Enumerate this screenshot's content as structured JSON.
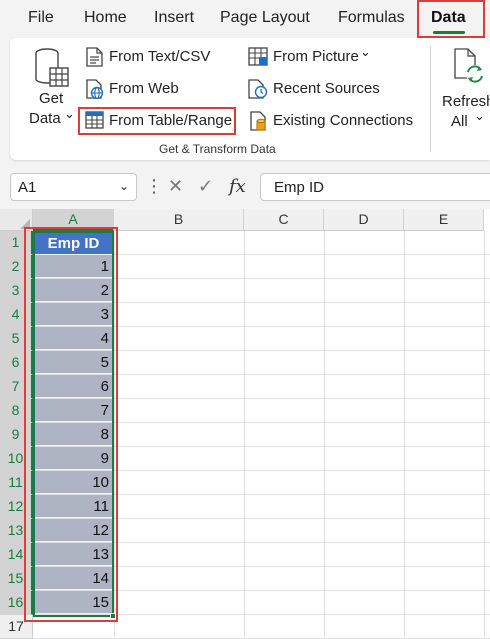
{
  "menu": {
    "tabs": [
      "File",
      "Home",
      "Insert",
      "Page Layout",
      "Formulas",
      "Data"
    ],
    "active": "Data"
  },
  "ribbon": {
    "get_data": {
      "line1": "Get",
      "line2": "Data",
      "chevron": "⌄"
    },
    "from_text_csv": "From Text/CSV",
    "from_web": "From Web",
    "from_table_range": "From Table/Range",
    "from_picture": "From Picture",
    "from_picture_chevron": "⌄",
    "recent_sources": "Recent Sources",
    "existing_connections": "Existing Connections",
    "group_label": "Get & Transform Data",
    "refresh_all": {
      "line1": "Refresh",
      "line2": "All",
      "chevron": "⌄"
    }
  },
  "formula_bar": {
    "name_box": "A1",
    "name_box_chevron": "⌄",
    "dots": "⋮",
    "cancel": "✕",
    "enter": "✓",
    "fx": "fx",
    "content": "Emp ID"
  },
  "sheet": {
    "columns": [
      "A",
      "B",
      "C",
      "D",
      "E"
    ],
    "rows": [
      "1",
      "2",
      "3",
      "4",
      "5",
      "6",
      "7",
      "8",
      "9",
      "10",
      "11",
      "12",
      "13",
      "14",
      "15",
      "16",
      "17"
    ],
    "column_a": {
      "header": "Emp ID",
      "values": [
        "1",
        "2",
        "3",
        "4",
        "5",
        "6",
        "7",
        "8",
        "9",
        "10",
        "11",
        "12",
        "13",
        "14",
        "15"
      ]
    }
  },
  "colors": {
    "accent_green": "#1e7a44",
    "table_header": "#4472c4",
    "table_cells": "#aeb4c4",
    "highlight_red": "#e03b3b"
  },
  "icons": [
    "get-data-database-icon",
    "text-file-icon",
    "web-globe-icon",
    "table-icon",
    "picture-icon",
    "recent-sources-icon",
    "existing-connections-icon",
    "refresh-icon",
    "cancel-icon",
    "enter-icon",
    "fx-icon"
  ]
}
